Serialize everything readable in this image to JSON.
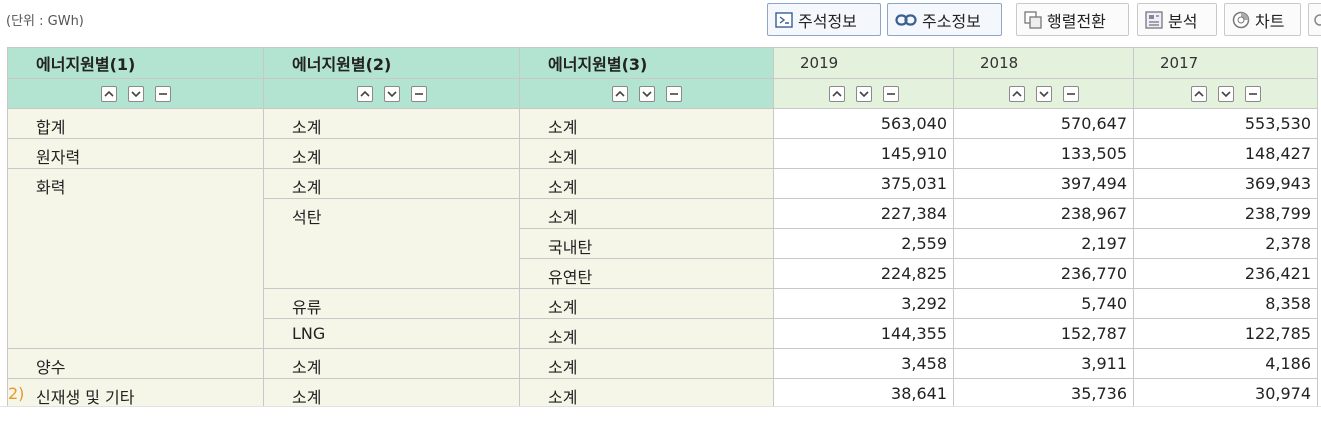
{
  "unit_label": "(단위 : GWh)",
  "toolbar": {
    "note_label": "주석정보",
    "address_label": "주소정보",
    "pivot_label": "행렬전환",
    "analysis_label": "분석",
    "chart_label": "차트"
  },
  "table": {
    "dim_headers": [
      "에너지원별(1)",
      "에너지원별(2)",
      "에너지원별(3)"
    ],
    "years": [
      "2019",
      "2018",
      "2017"
    ],
    "footnote_marker": "2)",
    "rows": [
      {
        "d1": "합계",
        "d2": "소계",
        "d3": "소계",
        "v": [
          "563,040",
          "570,647",
          "553,530"
        ]
      },
      {
        "d1": "원자력",
        "d2": "소계",
        "d3": "소계",
        "v": [
          "145,910",
          "133,505",
          "148,427"
        ]
      },
      {
        "d1": "화력",
        "d2": "소계",
        "d3": "소계",
        "v": [
          "375,031",
          "397,494",
          "369,943"
        ]
      },
      {
        "d1": "",
        "d2": "석탄",
        "d3": "소계",
        "v": [
          "227,384",
          "238,967",
          "238,799"
        ]
      },
      {
        "d1": "",
        "d2": "",
        "d3": "국내탄",
        "v": [
          "2,559",
          "2,197",
          "2,378"
        ]
      },
      {
        "d1": "",
        "d2": "",
        "d3": "유연탄",
        "v": [
          "224,825",
          "236,770",
          "236,421"
        ]
      },
      {
        "d1": "",
        "d2": "유류",
        "d3": "소계",
        "v": [
          "3,292",
          "5,740",
          "8,358"
        ]
      },
      {
        "d1": "",
        "d2": "LNG",
        "d3": "소계",
        "v": [
          "144,355",
          "152,787",
          "122,785"
        ]
      },
      {
        "d1": "양수",
        "d2": "소계",
        "d3": "소계",
        "v": [
          "3,458",
          "3,911",
          "4,186"
        ]
      },
      {
        "d1": "신재생 및 기타",
        "d2": "소계",
        "d3": "소계",
        "v": [
          "38,641",
          "35,736",
          "30,974"
        ]
      }
    ]
  },
  "icons": {
    "note": "note-icon",
    "address": "link-icon",
    "pivot": "pivot-icon",
    "analysis": "analysis-icon",
    "chart": "chart-icon",
    "sort_up": "chevron-up-icon",
    "sort_down": "chevron-down-icon",
    "remove": "minus-icon"
  },
  "colors": {
    "dim_header_bg": "#b2e4d1",
    "year_header_bg": "#e4f1dd",
    "label_cell_bg": "#f6f6e8",
    "footnote": "#e79a2a"
  }
}
